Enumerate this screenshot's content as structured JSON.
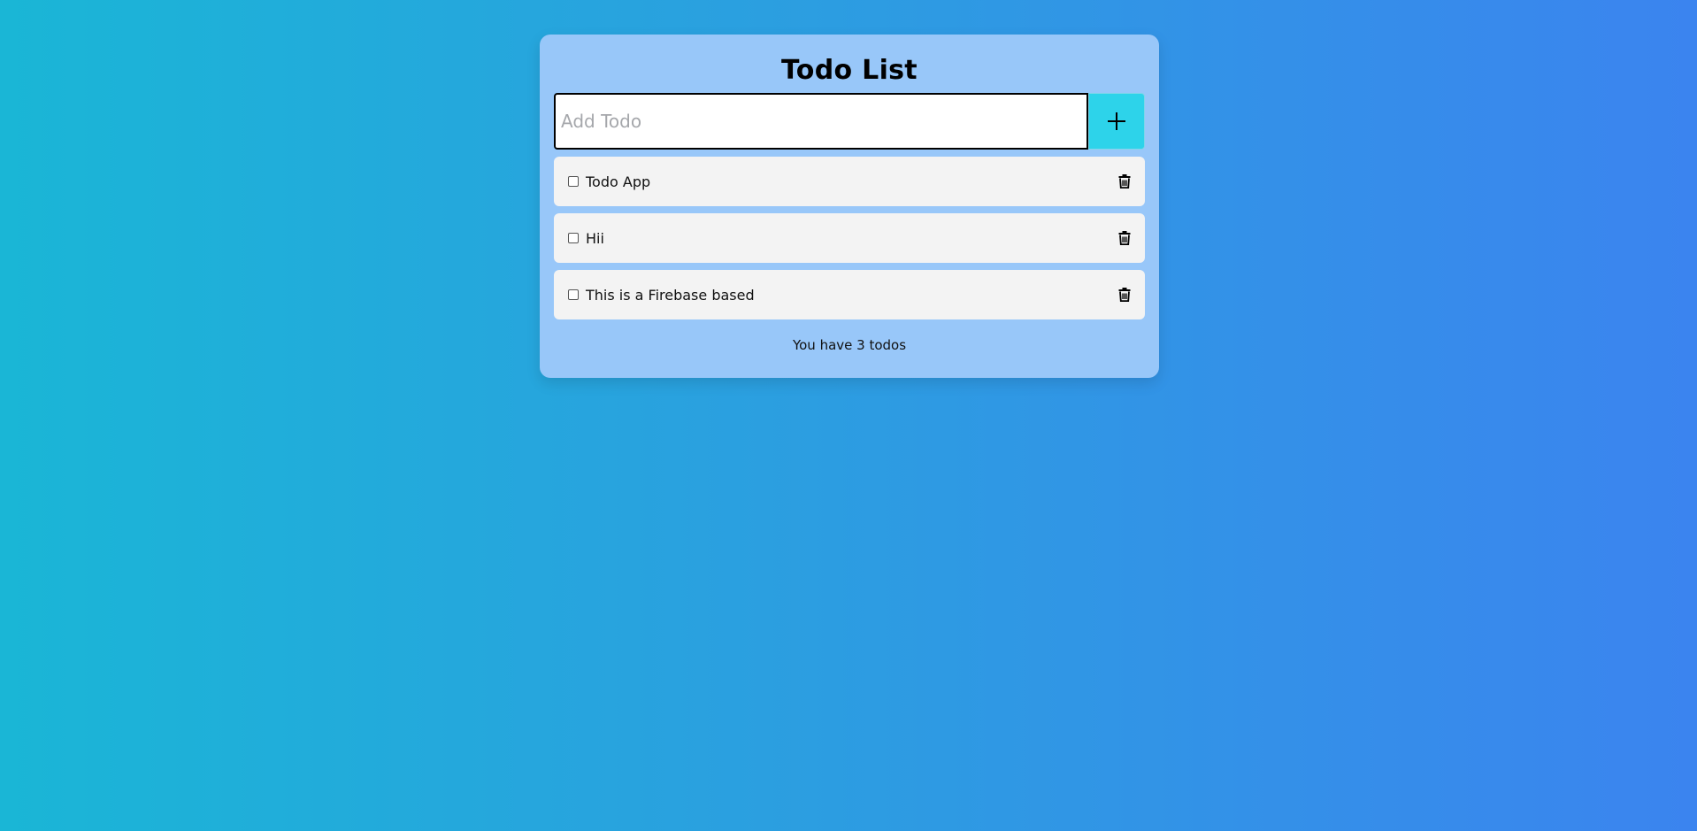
{
  "app": {
    "title": "Todo List"
  },
  "form": {
    "placeholder": "Add Todo",
    "value": "",
    "add_icon": "plus-icon"
  },
  "todos": [
    {
      "text": "Todo App",
      "completed": false,
      "delete_icon": "trash-icon"
    },
    {
      "text": "Hii",
      "completed": false,
      "delete_icon": "trash-icon"
    },
    {
      "text": "This is a Firebase based",
      "completed": false,
      "delete_icon": "trash-icon"
    }
  ],
  "footer": {
    "count_text": "You have 3 todos"
  },
  "colors": {
    "background_start": "#1ab6d6",
    "background_end": "#3b84ef",
    "card": "#98c7f9",
    "add_button": "#2dd3ea",
    "item_background": "#f3f3f3"
  }
}
